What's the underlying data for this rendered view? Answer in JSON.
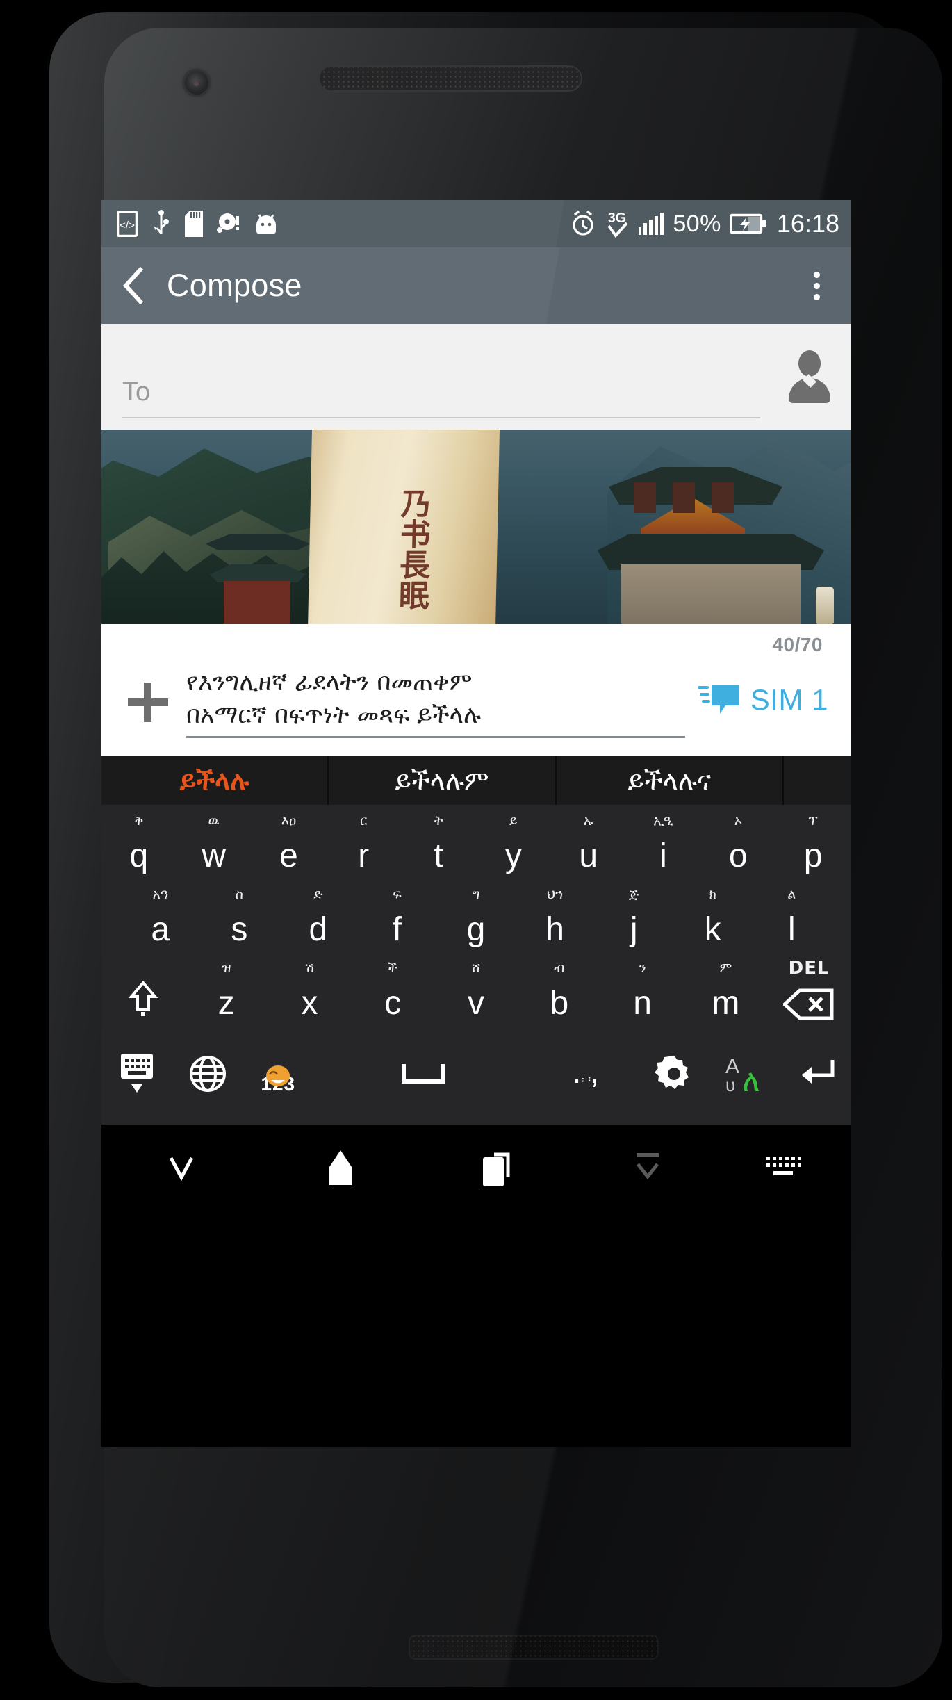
{
  "status_bar": {
    "left_icons": [
      "usb-debug-icon",
      "usb-icon",
      "sd-card-icon",
      "disc-alert-icon",
      "android-icon"
    ],
    "right_icons": [
      "alarm-icon",
      "3g-check-icon",
      "signal-bars-icon"
    ],
    "battery_percent": "50%",
    "battery_icon": "battery-charging-icon",
    "time": "16:18"
  },
  "appbar": {
    "back_icon": "back-chevron-icon",
    "title": "Compose",
    "overflow_icon": "overflow-menu-icon"
  },
  "recipient": {
    "placeholder": "To",
    "value": "",
    "contact_picker_icon": "contact-person-icon"
  },
  "attachment": {
    "type": "image-attachment",
    "description": "Photo of a Chinese temple on a mountainside with a calligraphy stone pillar",
    "calligraphy": "乃书長眠"
  },
  "compose": {
    "char_counter": "40/70",
    "add_icon": "plus-attach-icon",
    "message_line1": "የእንግሊዘኛ ፊደላትን በመጠቀም",
    "message_line2": "በአማርኛ በፍጥነት መጻፍ ይችላሉ",
    "send_icon": "send-message-icon",
    "send_label": "SIM 1",
    "send_color": "#3fafe0"
  },
  "suggestions": [
    {
      "text": "ይችላሉ",
      "active": true
    },
    {
      "text": "ይችላሉም",
      "active": false
    },
    {
      "text": "ይችላሉና",
      "active": false
    }
  ],
  "keyboard": {
    "row1": [
      {
        "glyph": "q",
        "hint": "ቅ"
      },
      {
        "glyph": "w",
        "hint": "ዉ"
      },
      {
        "glyph": "e",
        "hint": "እዐ"
      },
      {
        "glyph": "r",
        "hint": "ር"
      },
      {
        "glyph": "t",
        "hint": "ት"
      },
      {
        "glyph": "y",
        "hint": "ይ"
      },
      {
        "glyph": "u",
        "hint": "ኡ"
      },
      {
        "glyph": "i",
        "hint": "ኢዒ"
      },
      {
        "glyph": "o",
        "hint": "ኦ"
      },
      {
        "glyph": "p",
        "hint": "ፕ"
      }
    ],
    "row2": [
      {
        "glyph": "a",
        "hint": "አዓ"
      },
      {
        "glyph": "s",
        "hint": "ስ"
      },
      {
        "glyph": "d",
        "hint": "ድ"
      },
      {
        "glyph": "f",
        "hint": "ፍ"
      },
      {
        "glyph": "g",
        "hint": "ግ"
      },
      {
        "glyph": "h",
        "hint": "ህኀ"
      },
      {
        "glyph": "j",
        "hint": "ጅ"
      },
      {
        "glyph": "k",
        "hint": "ክ"
      },
      {
        "glyph": "l",
        "hint": "ል"
      }
    ],
    "row3": [
      {
        "glyph": "z",
        "hint": "ዝ"
      },
      {
        "glyph": "x",
        "hint": "ሽ"
      },
      {
        "glyph": "c",
        "hint": "ች"
      },
      {
        "glyph": "v",
        "hint": "ሸ"
      },
      {
        "glyph": "b",
        "hint": "ብ"
      },
      {
        "glyph": "n",
        "hint": "ን"
      },
      {
        "glyph": "m",
        "hint": "ም"
      }
    ],
    "shift_icon": "shift-key-icon",
    "delete_icon": "delete-key-icon",
    "delete_label": "DEL",
    "function_row": {
      "hide_keyboard_icon": "hide-keyboard-icon",
      "globe_icon": "language-globe-icon",
      "emoji_icon": "emoji-icon",
      "numbers_label": "123",
      "space_icon": "space-bar-icon",
      "punctuation_label": ". ,",
      "punctuation_hint": "፣\n፡",
      "settings_icon": "settings-gear-icon",
      "language_toggle_label_latin": "A",
      "language_toggle_label_amharic": "ለ",
      "enter_icon": "enter-key-icon"
    }
  },
  "navbar": {
    "back_icon": "nav-back-icon",
    "home_icon": "nav-home-icon",
    "recents_icon": "nav-recents-icon",
    "hide_ime_icon": "nav-hide-ime-icon",
    "switch_ime_icon": "nav-switch-keyboard-icon"
  }
}
